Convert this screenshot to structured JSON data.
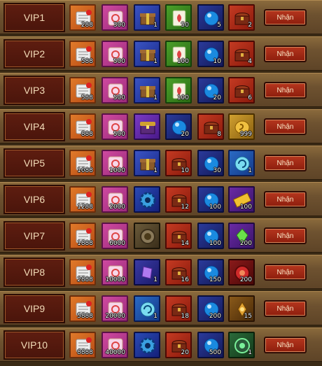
{
  "claim_label": "Nhận",
  "tiers": [
    {
      "label": "VIP1",
      "items": [
        {
          "icon": "scroll-icon",
          "count": "288"
        },
        {
          "icon": "pink-scroll-icon",
          "count": "300"
        },
        {
          "icon": "gift-box-icon",
          "count": "1"
        },
        {
          "icon": "green-leaf-card-icon",
          "count": "50"
        },
        {
          "icon": "blue-orb-icon",
          "count": "5"
        },
        {
          "icon": "treasure-chest-icon",
          "count": "2"
        }
      ]
    },
    {
      "label": "VIP2",
      "items": [
        {
          "icon": "scroll-icon",
          "count": "588"
        },
        {
          "icon": "pink-scroll-icon",
          "count": "500"
        },
        {
          "icon": "gift-box-icon",
          "count": "1"
        },
        {
          "icon": "green-leaf-card-icon",
          "count": "100"
        },
        {
          "icon": "blue-orb-icon",
          "count": "10"
        },
        {
          "icon": "treasure-chest-icon",
          "count": "4"
        }
      ]
    },
    {
      "label": "VIP3",
      "items": [
        {
          "icon": "scroll-icon",
          "count": "588"
        },
        {
          "icon": "pink-scroll-icon",
          "count": "500"
        },
        {
          "icon": "gift-box-icon",
          "count": "1"
        },
        {
          "icon": "green-leaf-card-icon",
          "count": "100"
        },
        {
          "icon": "blue-orb-icon",
          "count": "20"
        },
        {
          "icon": "treasure-chest-icon",
          "count": "6"
        }
      ]
    },
    {
      "label": "VIP4",
      "items": [
        {
          "icon": "scroll-icon",
          "count": "888"
        },
        {
          "icon": "pink-scroll-icon",
          "count": "500"
        },
        {
          "icon": "purple-chest-icon",
          "count": ""
        },
        {
          "icon": "blue-orb-icon",
          "count": "20"
        },
        {
          "icon": "treasure-chest-icon",
          "count": "8"
        },
        {
          "icon": "gold-coin-icon",
          "count": "999"
        }
      ]
    },
    {
      "label": "VIP5",
      "items": [
        {
          "icon": "scroll-icon",
          "count": "1088"
        },
        {
          "icon": "pink-scroll-icon",
          "count": "1000"
        },
        {
          "icon": "gift-box-icon",
          "count": "1"
        },
        {
          "icon": "treasure-chest-icon",
          "count": "10"
        },
        {
          "icon": "blue-orb-icon",
          "count": "30"
        },
        {
          "icon": "cyan-swirl-icon",
          "count": "1"
        }
      ]
    },
    {
      "label": "VIP6",
      "items": [
        {
          "icon": "scroll-icon",
          "count": "1288"
        },
        {
          "icon": "pink-scroll-icon",
          "count": "2000"
        },
        {
          "icon": "blue-gear-icon",
          "count": ""
        },
        {
          "icon": "treasure-chest-icon",
          "count": "12"
        },
        {
          "icon": "blue-orb-icon",
          "count": "100"
        },
        {
          "icon": "gold-ticket-icon",
          "count": "100"
        }
      ]
    },
    {
      "label": "VIP7",
      "items": [
        {
          "icon": "scroll-icon",
          "count": "1888"
        },
        {
          "icon": "pink-scroll-icon",
          "count": "6000"
        },
        {
          "icon": "bronze-ring-icon",
          "count": ""
        },
        {
          "icon": "treasure-chest-icon",
          "count": "14"
        },
        {
          "icon": "blue-orb-icon",
          "count": "100"
        },
        {
          "icon": "green-crystal-icon",
          "count": "200"
        }
      ]
    },
    {
      "label": "VIP8",
      "items": [
        {
          "icon": "scroll-icon",
          "count": "2888"
        },
        {
          "icon": "pink-scroll-icon",
          "count": "10000"
        },
        {
          "icon": "purple-crystal-icon",
          "count": "1"
        },
        {
          "icon": "treasure-chest-icon",
          "count": "16"
        },
        {
          "icon": "blue-orb-icon",
          "count": "150"
        },
        {
          "icon": "red-orb-icon",
          "count": "200"
        }
      ]
    },
    {
      "label": "VIP9",
      "items": [
        {
          "icon": "scroll-icon",
          "count": "5888"
        },
        {
          "icon": "pink-scroll-icon",
          "count": "20000"
        },
        {
          "icon": "cyan-swirl-icon",
          "count": "1"
        },
        {
          "icon": "treasure-chest-icon",
          "count": "18"
        },
        {
          "icon": "blue-orb-icon",
          "count": "200"
        },
        {
          "icon": "gold-wing-icon",
          "count": "15"
        }
      ]
    },
    {
      "label": "VIP10",
      "items": [
        {
          "icon": "scroll-icon",
          "count": "8888"
        },
        {
          "icon": "pink-scroll-icon",
          "count": "40000"
        },
        {
          "icon": "blue-gear-icon",
          "count": ""
        },
        {
          "icon": "treasure-chest-icon",
          "count": "20"
        },
        {
          "icon": "blue-orb-icon",
          "count": "500"
        },
        {
          "icon": "green-emblem-icon",
          "count": "1"
        }
      ]
    }
  ]
}
